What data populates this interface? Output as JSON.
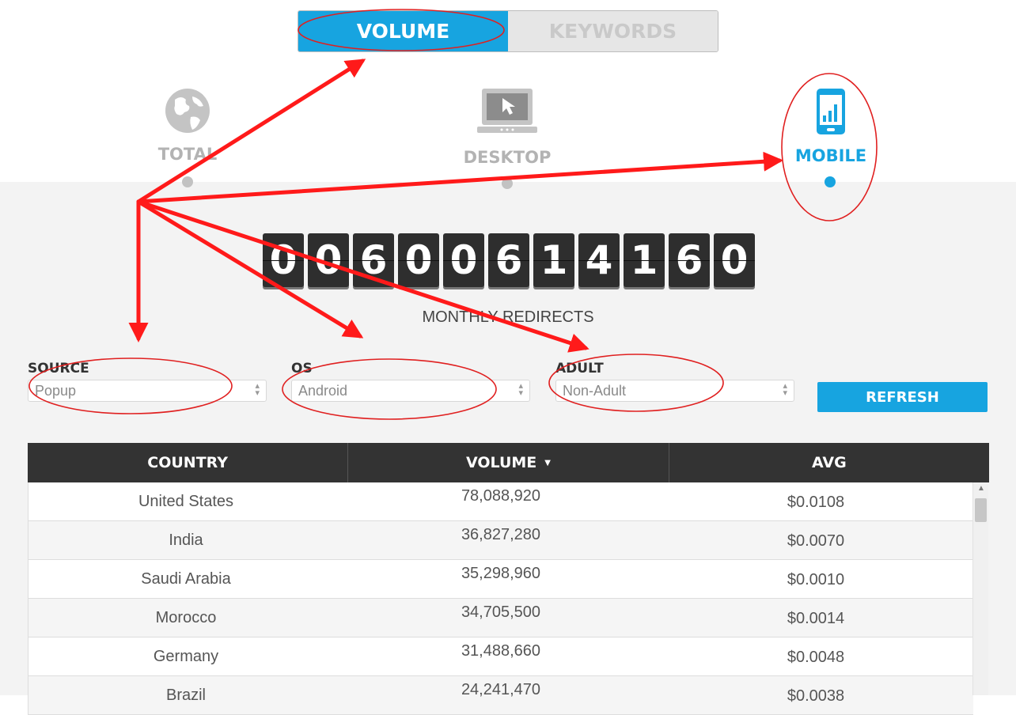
{
  "tabs": [
    {
      "label": "VOLUME",
      "active": true
    },
    {
      "label": "KEYWORDS",
      "active": false
    }
  ],
  "devices": [
    {
      "label": "TOTAL",
      "icon": "globe-icon",
      "selected": false
    },
    {
      "label": "DESKTOP",
      "icon": "desktop-monitor-icon",
      "selected": false
    },
    {
      "label": "MOBILE",
      "icon": "mobile-phone-icon",
      "selected": true
    }
  ],
  "counter": {
    "digits": [
      "0",
      "0",
      "6",
      "0",
      "0",
      "6",
      "1",
      "4",
      "1",
      "6",
      "0"
    ],
    "label": "MONTHLY REDIRECTS"
  },
  "filters": {
    "source": {
      "label": "SOURCE",
      "value": "Popup"
    },
    "os": {
      "label": "OS",
      "value": "Android"
    },
    "adult": {
      "label": "ADULT",
      "value": "Non-Adult"
    },
    "refresh_label": "REFRESH"
  },
  "table": {
    "headers": [
      "COUNTRY",
      "VOLUME",
      "AVG"
    ],
    "sort_indicator": "▼",
    "rows": [
      {
        "country": "United States",
        "volume": "78,088,920",
        "avg": "$0.0108"
      },
      {
        "country": "India",
        "volume": "36,827,280",
        "avg": "$0.0070"
      },
      {
        "country": "Saudi Arabia",
        "volume": "35,298,960",
        "avg": "$0.0010"
      },
      {
        "country": "Morocco",
        "volume": "34,705,500",
        "avg": "$0.0014"
      },
      {
        "country": "Germany",
        "volume": "31,488,660",
        "avg": "$0.0048"
      },
      {
        "country": "Brazil",
        "volume": "24,241,470",
        "avg": "$0.0038"
      }
    ]
  },
  "colors": {
    "accent": "#17a4e0",
    "annotation": "#ff1a1a",
    "header_bg": "#333333"
  }
}
